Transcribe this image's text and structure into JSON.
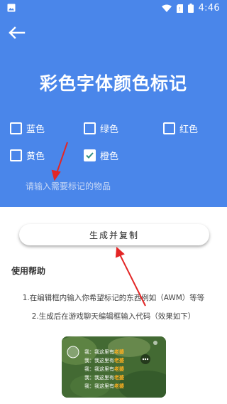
{
  "status_bar": {
    "time": "4:46"
  },
  "header": {
    "title": "彩色字体颜色标记"
  },
  "colors": {
    "hero": "#4a86ea",
    "checkmark": "#2f8f86",
    "annotation_arrow": "#e32626"
  },
  "checkboxes": [
    {
      "label": "蓝色",
      "checked": false
    },
    {
      "label": "绿色",
      "checked": false
    },
    {
      "label": "红色",
      "checked": false
    },
    {
      "label": "黄色",
      "checked": false
    },
    {
      "label": "橙色",
      "checked": true
    }
  ],
  "input": {
    "placeholder": "请输入需要标记的物品",
    "value": ""
  },
  "actions": {
    "generate_label": "生成并复制"
  },
  "help": {
    "title": "使用帮助",
    "line1": "1.在编辑框内输入你希望标记的东西例如（AWM）等等",
    "line2": "2.生成后在游戏聊天编辑框输入代码（效果如下）"
  },
  "preview": {
    "lines": [
      {
        "prefix": "我：我这里有",
        "highlight": "老婆"
      },
      {
        "prefix": "我：我这里有",
        "highlight": "老婆"
      },
      {
        "prefix": "我：我这里有",
        "highlight": "老婆"
      },
      {
        "prefix": "我：我这里有",
        "highlight": "老婆"
      },
      {
        "prefix": "我：我这里有",
        "highlight": "老婆"
      }
    ]
  }
}
